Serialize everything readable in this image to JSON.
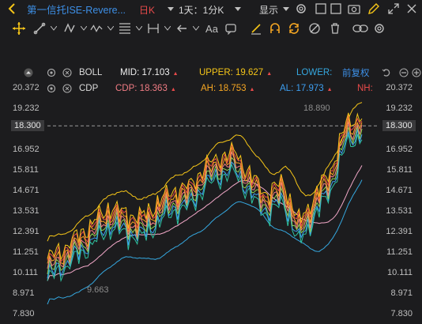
{
  "header": {
    "title": "第一信托ISE-Revere...",
    "period": "日K",
    "interval": "1天：1分K",
    "display": "显示"
  },
  "indicators": {
    "boll": {
      "name": "BOLL",
      "mid_label": "MID: 17.103",
      "upper_label": "UPPER: 19.627",
      "lower_label": "LOWER:",
      "adjust": "前复权"
    },
    "cdp": {
      "name": "CDP",
      "cdp_label": "CDP: 18.363",
      "ah_label": "AH: 18.753",
      "al_label": "AL: 17.973",
      "nh_label": "NH:"
    }
  },
  "axis": {
    "ticks": [
      "20.372",
      "19.232",
      "18.300",
      "16.952",
      "15.811",
      "14.671",
      "13.531",
      "12.391",
      "11.251",
      "10.111",
      "8.971",
      "7.830"
    ],
    "current_price": "18.300"
  },
  "annotations": {
    "high": "18.890",
    "low": "9.663"
  },
  "colors": {
    "accent": "#3d8fe6",
    "boll_mid": "#f0f0f0",
    "boll_upper": "#f5c518",
    "boll_lower": "#35a8e0",
    "cdp": "#f07c84",
    "ah": "#f5a623",
    "al": "#3d9ef0",
    "nh": "#e84a4a",
    "triangle_up": "#e84a4a"
  },
  "icons": [
    "crosshair-icon",
    "line-tool-icon",
    "ray-tool-icon",
    "pattern-icon",
    "fib-icon",
    "measure-icon",
    "arrow-icon",
    "text-icon",
    "note-icon",
    "pen-icon",
    "magnet-icon",
    "sync-icon",
    "hide-icon",
    "delete-icon",
    "link-icon",
    "settings-icon",
    "camera-icon",
    "edit-icon",
    "fullscreen-icon"
  ]
}
